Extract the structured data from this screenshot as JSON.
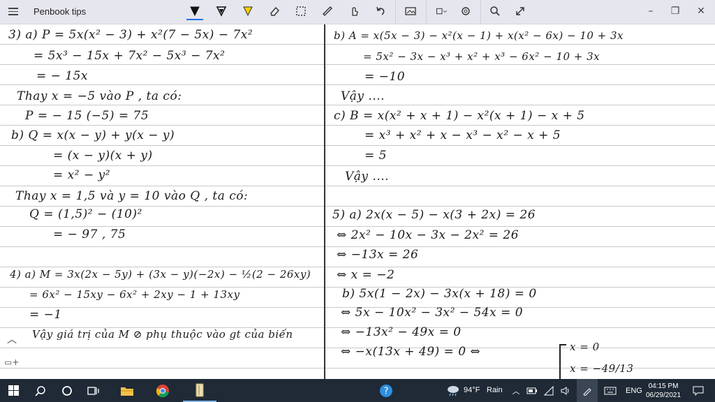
{
  "titlebar": {
    "app_title": "Penbook tips",
    "tools": [
      "pen-icon",
      "pen-icon",
      "highlighter-icon",
      "eraser-icon",
      "lasso-icon",
      "ruler-icon",
      "touch-writing-icon",
      "undo-icon",
      "image-icon",
      "shape-icon",
      "settings-icon",
      "zoom-icon",
      "expand-icon"
    ],
    "window_buttons": {
      "minimize": "–",
      "maximize": "❐",
      "close": "✕"
    }
  },
  "notes": {
    "left": [
      "3) a) P = 5x(x² − 3) + x²(7 − 5x) − 7x²",
      "= 5x³ − 15x + 7x² − 5x³ − 7x²",
      "= − 15x",
      "Thay x = −5 vào P , ta có:",
      "P = − 15 (−5) = 75",
      "b) Q = x(x − y) + y(x − y)",
      "= (x − y)(x + y)",
      "= x² − y²",
      "Thay x = 1,5 và y = 10 vào Q , ta có:",
      "Q = (1,5)² − (10)²",
      "= − 97 , 75",
      "4) a) M = 3x(2x − 5y) + (3x − y)(−2x) − ½(2 − 26xy)",
      "= 6x² − 15xy − 6x² + 2xy − 1 + 13xy",
      "= −1",
      "Vậy giá trị của M ⊘ phụ thuộc vào gt của biến"
    ],
    "right": [
      "b) A = x(5x − 3) − x²(x − 1) + x(x² − 6x) − 10 + 3x",
      "= 5x² − 3x − x³ + x² + x³ − 6x² − 10 + 3x",
      "= −10",
      "Vậy ....",
      "c) B = x(x² + x + 1) − x²(x + 1) − x + 5",
      "= x³ + x² + x − x³ − x² − x + 5",
      "= 5",
      "Vậy ....",
      "5) a) 2x(x − 5) − x(3 + 2x) = 26",
      "⇔ 2x² − 10x − 3x − 2x² = 26",
      "⇔ −13x = 26",
      "⇔ x = −2",
      "b) 5x(1 − 2x) − 3x(x + 18) = 0",
      "⇔ 5x − 10x² − 3x² − 54x = 0",
      "⇔ −13x² − 49x = 0",
      "⇔ −x(13x + 49) = 0 ⇔",
      "x = 0",
      "x = −49/13"
    ]
  },
  "taskbar": {
    "weather_temp": "94°F",
    "weather_text": "Rain",
    "language": "ENG",
    "time": "04:15 PM",
    "date": "06/29/2021"
  }
}
